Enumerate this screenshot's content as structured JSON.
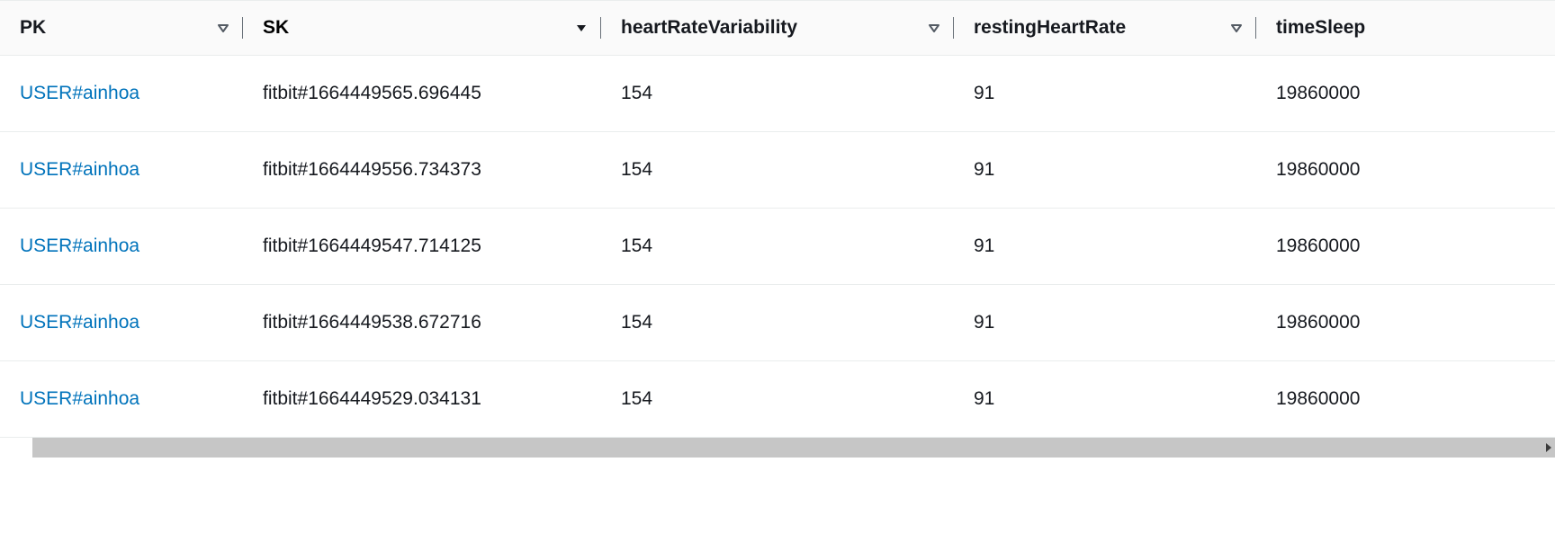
{
  "columns": {
    "pk": {
      "label": "PK",
      "sorted": "none"
    },
    "sk": {
      "label": "SK",
      "sorted": "desc"
    },
    "hrv": {
      "label": "heartRateVariability",
      "sorted": "none"
    },
    "rhr": {
      "label": "restingHeartRate",
      "sorted": "none"
    },
    "ts": {
      "label": "timeSleep",
      "sorted": "none"
    }
  },
  "rows": [
    {
      "pk": "USER#ainhoa",
      "sk": "fitbit#1664449565.696445",
      "hrv": "154",
      "rhr": "91",
      "ts": "19860000"
    },
    {
      "pk": "USER#ainhoa",
      "sk": "fitbit#1664449556.734373",
      "hrv": "154",
      "rhr": "91",
      "ts": "19860000"
    },
    {
      "pk": "USER#ainhoa",
      "sk": "fitbit#1664449547.714125",
      "hrv": "154",
      "rhr": "91",
      "ts": "19860000"
    },
    {
      "pk": "USER#ainhoa",
      "sk": "fitbit#1664449538.672716",
      "hrv": "154",
      "rhr": "91",
      "ts": "19860000"
    },
    {
      "pk": "USER#ainhoa",
      "sk": "fitbit#1664449529.034131",
      "hrv": "154",
      "rhr": "91",
      "ts": "19860000"
    }
  ]
}
